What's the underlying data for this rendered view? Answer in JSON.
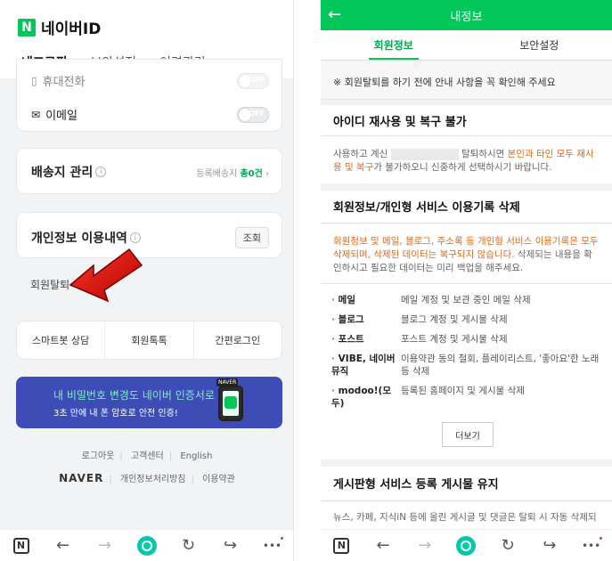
{
  "left": {
    "logo": {
      "mark": "N",
      "text": "네이버ID"
    },
    "tabs": [
      "내프로필",
      "보안설정",
      "이력관리"
    ],
    "contact": {
      "phone_label": "휴대전화",
      "email_label": "이메일",
      "toggle_off": "OFF"
    },
    "shipping": {
      "title": "배송지 관리",
      "meta_prefix": "등록배송지",
      "count": "총0건",
      "chevron": "›"
    },
    "privacy": {
      "title": "개인정보 이용내역",
      "button": "조회"
    },
    "withdraw_label": "회원탈퇴",
    "quick_links": [
      "스마트봇 상담",
      "회원톡톡",
      "간편로그인"
    ],
    "banner": {
      "line1": "내 비밀번호 변경도 네이버 인증서로",
      "line2": "3초 만에 내 폰 암호로 안전 인증!",
      "phone_label": "NAVER"
    },
    "footer": {
      "links1": [
        "로그아웃",
        "고객센터",
        "English"
      ],
      "brand": "NAVER",
      "links2": [
        "개인정보처리방침",
        "이용약관"
      ]
    }
  },
  "right": {
    "header_title": "내정보",
    "back_icon": "←",
    "tabs": [
      "회원정보",
      "보안설정"
    ],
    "notice": "※ 회원탈퇴를 하기 전에 안내 사항을 꼭 확인해 주세요",
    "sec1": {
      "title": "아이디 재사용 및 복구 불가",
      "p_before": "사용하고 계신",
      "p_mid": "탈퇴하시면",
      "p_orange": "본인과 타인 모두 재사용 및 복구",
      "p_after": "가 불가하오니 신중하게 선택하시기 바랍니다."
    },
    "sec2": {
      "title": "회원정보/개인형 서비스 이용기록 삭제",
      "p_orange": "회원정보 및 메일, 블로그, 주소록 등 개인형 서비스 이용기록은 모두 삭제되며, 삭제된 데이터는 복구되지 않습니다.",
      "p_after": " 삭제되는 내용을 확인하시고 필요한 데이터는 미리 백업을 해주세요.",
      "items": [
        {
          "k": "메일",
          "v": "메일 계정 및 보관 중인 메일 삭제"
        },
        {
          "k": "블로그",
          "v": "블로그 계정 및 게시물 삭제"
        },
        {
          "k": "포스트",
          "v": "포스트 계정 및 게시물 삭제"
        },
        {
          "k": "VIBE, 네이버뮤직",
          "v": "이용약관 동의 철회, 플레이리스트, '좋아요'한 노래 등 삭제"
        },
        {
          "k": "modoo!(모두)",
          "v": "등록된 홈페이지 및 게시물 삭제"
        }
      ],
      "more_button": "더보기"
    },
    "sec3": {
      "title": "게시판형 서비스 등록 게시물 유지",
      "p": "뉴스, 카페, 지식iN 등에 올린 게시글 및 댓글은 탈퇴 시 자동 삭제되"
    }
  },
  "bottom_nav": {
    "n_mark": "N",
    "back": "←",
    "forward": "→",
    "refresh": "↻",
    "share": "↪",
    "more": "•••"
  },
  "colors": {
    "naver_green": "#03c75a",
    "banner": "#3e4cb5",
    "warning_orange": "#e26a1a",
    "arrow_red": "#d40000"
  }
}
